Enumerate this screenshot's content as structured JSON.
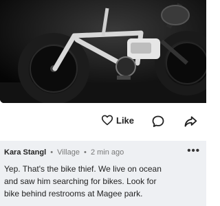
{
  "post": {
    "photo_icon": "bike-photo"
  },
  "actions": {
    "like_label": "Like",
    "comment_icon": "comment-icon",
    "share_icon": "share-icon"
  },
  "comment": {
    "author": "Kara Stangl",
    "neighborhood": "Village",
    "timestamp": "2 min ago",
    "separator": "•",
    "more_icon": "•••",
    "lines": [
      "Yep. That's the bike thief.  We live on ocean",
      "and saw  him searching for bikes.  Look for",
      "bike behind restrooms at Magee park."
    ]
  },
  "colors": {
    "photo_bg": "#0d0d0d",
    "comment_bg": "#eef0f3",
    "text": "#222222",
    "meta": "#777777"
  }
}
